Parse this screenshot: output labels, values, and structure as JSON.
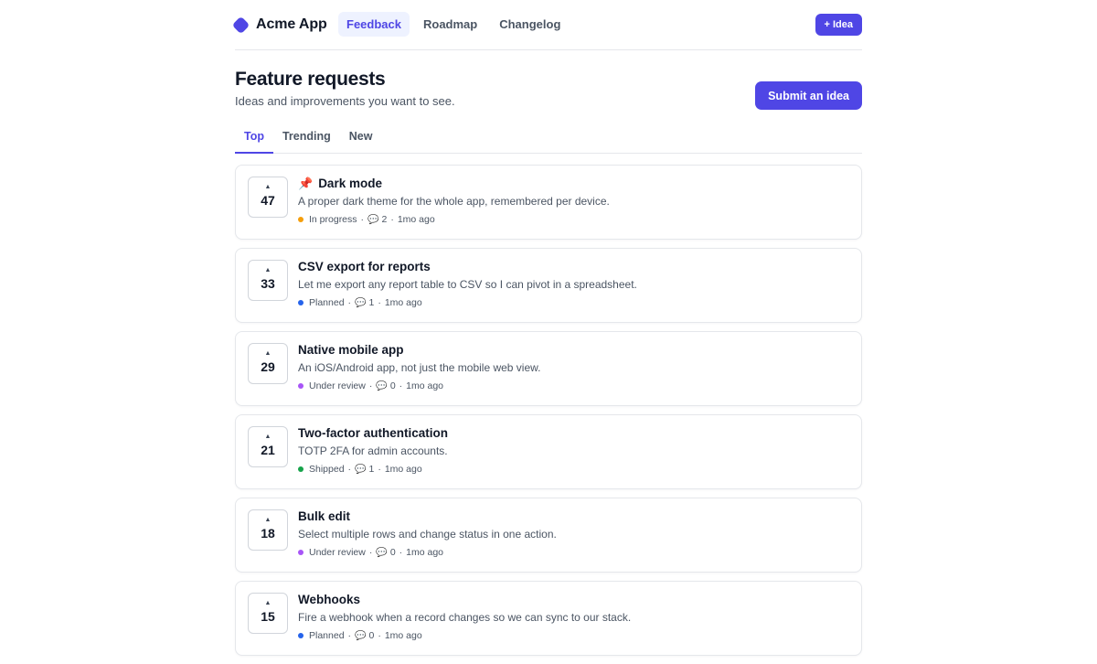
{
  "nav": {
    "brand": "Acme App",
    "links": [
      "Feedback",
      "Roadmap",
      "Changelog"
    ],
    "active": 0,
    "idea_button": "+ Idea",
    "brand_color": "#4f46e5"
  },
  "header": {
    "title": "Feature requests",
    "subtitle": "Ideas and improvements you want to see.",
    "submit_button": "Submit an idea"
  },
  "tabs": {
    "items": [
      "Top",
      "Trending",
      "New"
    ],
    "active": 0
  },
  "status_colors": {
    "In progress": "#f59e0b",
    "Planned": "#2563eb",
    "Under review": "#a855f7",
    "Shipped": "#16a34a"
  },
  "requests": [
    {
      "votes": "47",
      "pinned": true,
      "title": "Dark mode",
      "description": "A proper dark theme for the whole app, remembered per device.",
      "status": "In progress",
      "comments": "2",
      "age": "1mo ago"
    },
    {
      "votes": "33",
      "pinned": false,
      "title": "CSV export for reports",
      "description": "Let me export any report table to CSV so I can pivot in a spreadsheet.",
      "status": "Planned",
      "comments": "1",
      "age": "1mo ago"
    },
    {
      "votes": "29",
      "pinned": false,
      "title": "Native mobile app",
      "description": "An iOS/Android app, not just the mobile web view.",
      "status": "Under review",
      "comments": "0",
      "age": "1mo ago"
    },
    {
      "votes": "21",
      "pinned": false,
      "title": "Two-factor authentication",
      "description": "TOTP 2FA for admin accounts.",
      "status": "Shipped",
      "comments": "1",
      "age": "1mo ago"
    },
    {
      "votes": "18",
      "pinned": false,
      "title": "Bulk edit",
      "description": "Select multiple rows and change status in one action.",
      "status": "Under review",
      "comments": "0",
      "age": "1mo ago"
    },
    {
      "votes": "15",
      "pinned": false,
      "title": "Webhooks",
      "description": "Fire a webhook when a record changes so we can sync to our stack.",
      "status": "Planned",
      "comments": "0",
      "age": "1mo ago"
    }
  ]
}
